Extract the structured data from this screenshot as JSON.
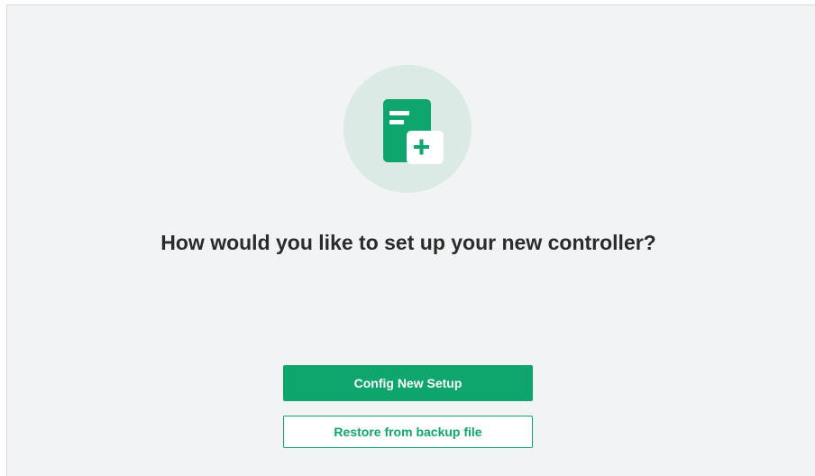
{
  "setup": {
    "title": "How would you like to set up your new controller?",
    "primary_button_label": "Config New Setup",
    "secondary_button_label": "Restore from backup file",
    "hero_icon": "document-add-icon"
  },
  "colors": {
    "accent": "#0ea66c",
    "panel_background": "#f2f3f5",
    "hero_circle": "#dbeae4"
  }
}
